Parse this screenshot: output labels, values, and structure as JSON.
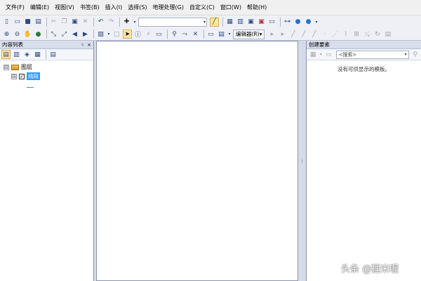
{
  "menubar": {
    "items": [
      "文件(F)",
      "编辑(E)",
      "视图(V)",
      "书签(B)",
      "插入(I)",
      "选择(S)",
      "地理处理(G)",
      "自定义(C)",
      "窗口(W)",
      "帮助(H)"
    ]
  },
  "toolbar": {
    "editor_label": "编辑器(R)"
  },
  "toc": {
    "title": "内容列表",
    "pin": "♮",
    "close": "×",
    "root_label": "图层",
    "layer_label": "线段",
    "expand_glyph": "⊟",
    "collapse_glyph": "⊟",
    "check_glyph": "✓"
  },
  "create_features": {
    "title": "创建要素",
    "search_placeholder": "<搜索>",
    "empty_message": "没有可供显示的模板。"
  },
  "watermark": {
    "text": "头条 @狸米喔"
  },
  "colors": {
    "selected_layer": "#3399ff",
    "panel_title_bg": "#d7deec",
    "chrome_bg": "#d6dbe9"
  }
}
